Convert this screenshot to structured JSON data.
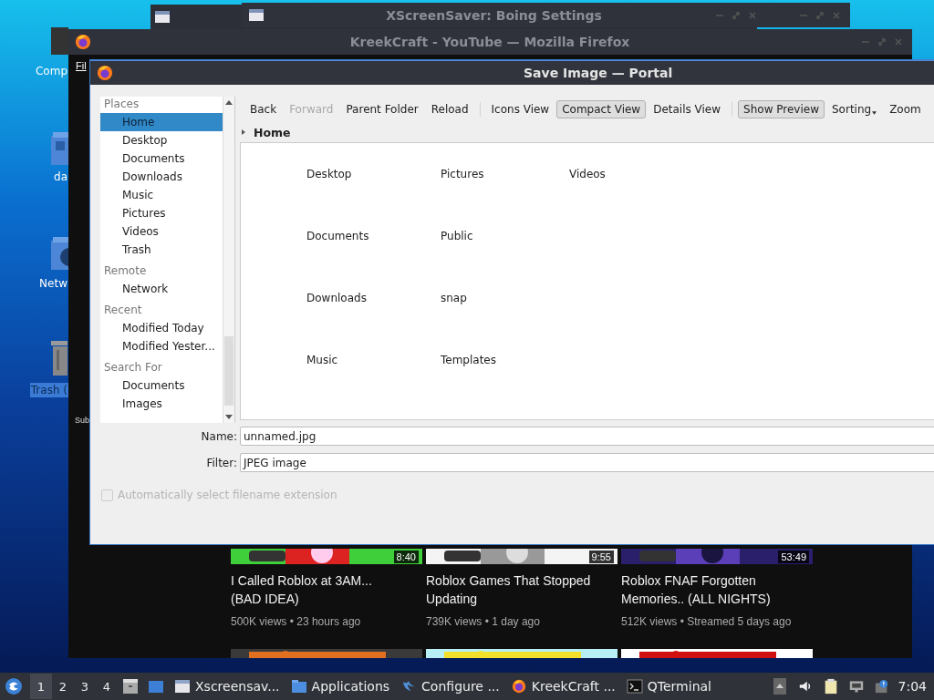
{
  "desktop": {
    "icons": [
      {
        "label": "Comp",
        "kind": "computer",
        "selected": false
      },
      {
        "label": "da",
        "kind": "folder",
        "selected": false
      },
      {
        "label": "Netw",
        "kind": "network",
        "selected": false
      },
      {
        "label": "Trash (",
        "kind": "trash",
        "selected": true
      }
    ]
  },
  "back_windows": [
    {
      "title": "XScreenSaver: Boing Settings"
    }
  ],
  "browser": {
    "title": "KreekCraft - YouTube — Mozilla Firefox",
    "menu": "Fil",
    "side_label": "Sub",
    "videos": [
      {
        "duration": "8:40",
        "title_lines": [
          "I Called Roblox at 3AM...",
          "(BAD IDEA)"
        ],
        "meta": "500K views • 23 hours ago"
      },
      {
        "duration": "9:55",
        "title_lines": [
          "Roblox Games That Stopped",
          "Updating"
        ],
        "meta": "739K views • 1 day ago"
      },
      {
        "duration": "53:49",
        "title_lines": [
          "Roblox FNAF Forgotten",
          "Memories.. (ALL NIGHTS)"
        ],
        "meta": "512K views • Streamed 5 days ago"
      }
    ]
  },
  "dialog": {
    "title": "Save Image — Portal",
    "places": [
      {
        "heading": "Places",
        "items": [
          {
            "label": "Home",
            "selected": true
          },
          {
            "label": "Desktop",
            "selected": false
          },
          {
            "label": "Documents",
            "selected": false
          },
          {
            "label": "Downloads",
            "selected": false
          },
          {
            "label": "Music",
            "selected": false
          },
          {
            "label": "Pictures",
            "selected": false
          },
          {
            "label": "Videos",
            "selected": false
          },
          {
            "label": "Trash",
            "selected": false
          }
        ]
      },
      {
        "heading": "Remote",
        "items": [
          {
            "label": "Network",
            "selected": false
          }
        ]
      },
      {
        "heading": "Recent",
        "items": [
          {
            "label": "Modified Today",
            "selected": false
          },
          {
            "label": "Modified Yester...",
            "selected": false
          }
        ]
      },
      {
        "heading": "Search For",
        "items": [
          {
            "label": "Documents",
            "selected": false
          },
          {
            "label": "Images",
            "selected": false
          }
        ]
      }
    ],
    "toolbar_groups": [
      [
        {
          "label": "Back",
          "pressed": false,
          "disabled": false,
          "menu": false
        },
        {
          "label": "Forward",
          "pressed": false,
          "disabled": true,
          "menu": false
        },
        {
          "label": "Parent Folder",
          "pressed": false,
          "disabled": false,
          "menu": false
        },
        {
          "label": "Reload",
          "pressed": false,
          "disabled": false,
          "menu": false
        }
      ],
      [
        {
          "label": "Icons View",
          "pressed": false,
          "disabled": false,
          "menu": false
        },
        {
          "label": "Compact View",
          "pressed": true,
          "disabled": false,
          "menu": false
        },
        {
          "label": "Details View",
          "pressed": false,
          "disabled": false,
          "menu": false
        }
      ],
      [
        {
          "label": "Show Preview",
          "pressed": true,
          "disabled": false,
          "menu": false
        },
        {
          "label": "Sorting",
          "pressed": false,
          "disabled": false,
          "menu": true
        },
        {
          "label": "Zoom",
          "pressed": false,
          "disabled": false,
          "menu": false
        }
      ]
    ],
    "breadcrumb": "Home",
    "files": [
      "Desktop",
      "Documents",
      "Downloads",
      "Music",
      "Pictures",
      "Public",
      "snap",
      "Templates",
      "Videos"
    ],
    "name_label": "Name:",
    "name_value": "unnamed.jpg",
    "filter_label": "Filter:",
    "filter_value": "JPEG image",
    "auto_extension": {
      "label": "Automatically select filename extension",
      "checked": false,
      "disabled": true
    }
  },
  "taskbar": {
    "workspaces": [
      {
        "label": "1",
        "selected": true
      },
      {
        "label": "2",
        "selected": false
      },
      {
        "label": "3",
        "selected": false
      },
      {
        "label": "4",
        "selected": false
      }
    ],
    "tasks": [
      {
        "label": "Xscreensav...",
        "kind": "window"
      },
      {
        "label": "Applications",
        "kind": "folder"
      },
      {
        "label": "Configure ...",
        "kind": "bird"
      },
      {
        "label": "KreekCraft ...",
        "kind": "firefox"
      },
      {
        "label": "QTerminal",
        "kind": "terminal"
      }
    ],
    "clock": "7:04"
  }
}
